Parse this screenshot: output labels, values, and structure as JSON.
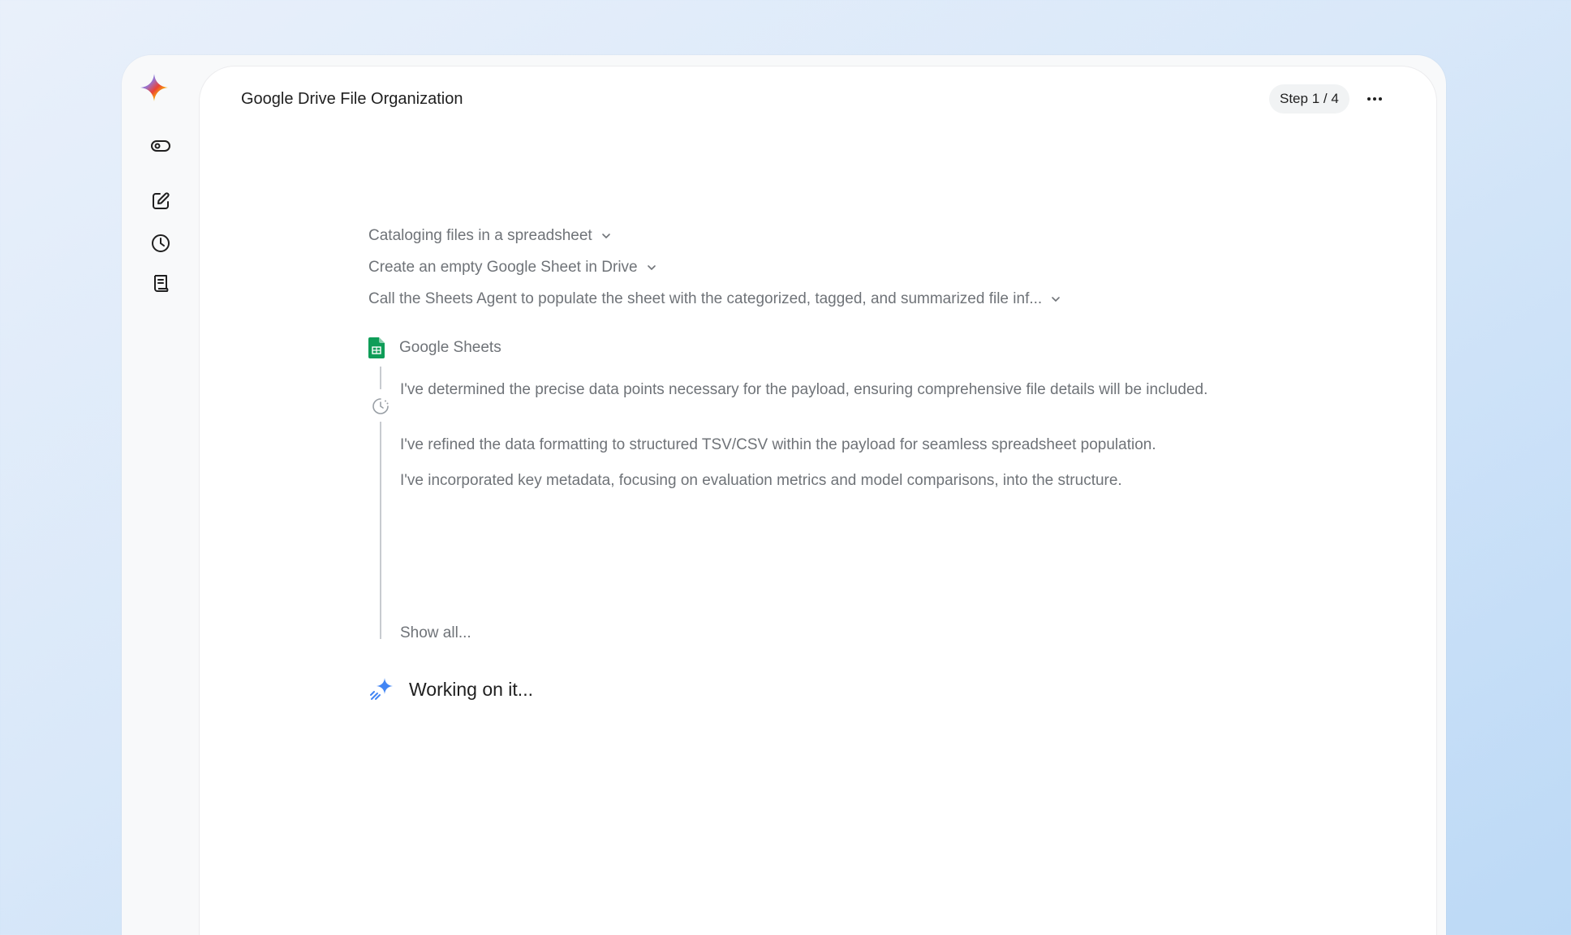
{
  "app": {
    "logo_icon": "gemini-sparkle-icon"
  },
  "rail": {
    "items": [
      {
        "name": "toggle-icon"
      },
      {
        "name": "new-chat-icon"
      },
      {
        "name": "history-icon"
      },
      {
        "name": "notes-icon"
      }
    ]
  },
  "header": {
    "title": "Google Drive File Organization",
    "step_label": "Step 1 / 4",
    "more_icon": "more-horizontal-icon"
  },
  "plan": {
    "steps": [
      {
        "label": "Cataloging files in a spreadsheet"
      },
      {
        "label": "Create an empty Google Sheet in Drive"
      },
      {
        "label": "Call the Sheets Agent to populate the sheet with the categorized, tagged, and summarized file inf..."
      }
    ]
  },
  "tool": {
    "name": "Google Sheets",
    "icon": "google-sheets-icon"
  },
  "thoughts": {
    "items": [
      "I've determined the precise data points necessary for the payload, ensuring comprehensive file details will be included.",
      "I've refined the data formatting to structured TSV/CSV within the payload for seamless spreadsheet population.",
      "I've incorporated key metadata, focusing on evaluation metrics and model comparisons, into the structure."
    ],
    "show_all_label": "Show all..."
  },
  "status": {
    "label": "Working on it..."
  },
  "colors": {
    "accent_blue": "#4285f4",
    "sheets_green": "#0f9d58",
    "muted_text": "#6f7378",
    "primary_text": "#1f1f1f"
  }
}
